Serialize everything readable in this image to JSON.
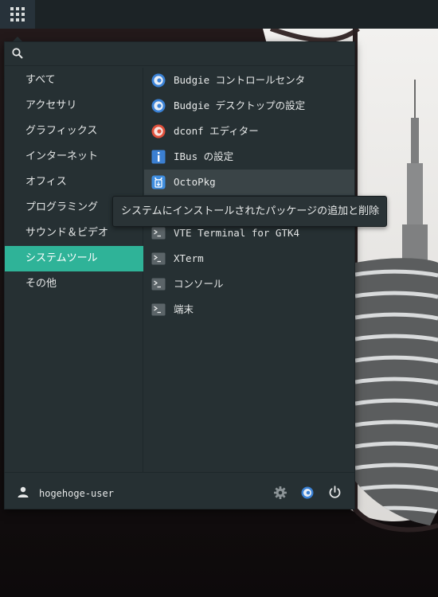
{
  "panel": {
    "apps_icon": "app-grid-icon"
  },
  "search": {
    "placeholder": "",
    "icon": "search-icon"
  },
  "categories": [
    {
      "label": "すべて",
      "active": false
    },
    {
      "label": "アクセサリ",
      "active": false
    },
    {
      "label": "グラフィックス",
      "active": false
    },
    {
      "label": "インターネット",
      "active": false
    },
    {
      "label": "オフィス",
      "active": false
    },
    {
      "label": "プログラミング",
      "active": false
    },
    {
      "label": "サウンド＆ビデオ",
      "active": false
    },
    {
      "label": "システムツール",
      "active": true
    },
    {
      "label": "その他",
      "active": false
    }
  ],
  "apps": [
    {
      "label": "Budgie コントロールセンタ",
      "icon": "budgie-icon"
    },
    {
      "label": "Budgie デスクトップの設定",
      "icon": "budgie-icon"
    },
    {
      "label": "dconf エディター",
      "icon": "dconf-icon"
    },
    {
      "label": "IBus の設定",
      "icon": "ibus-info-icon"
    },
    {
      "label": "OctoPkg",
      "icon": "octopkg-icon",
      "hover": true
    },
    {
      "label": "",
      "icon": "terminal-icon"
    },
    {
      "label": "VTE Terminal for GTK4",
      "icon": "terminal-icon"
    },
    {
      "label": "XTerm",
      "icon": "terminal-icon"
    },
    {
      "label": "コンソール",
      "icon": "terminal-icon"
    },
    {
      "label": "端末",
      "icon": "terminal-icon"
    }
  ],
  "tooltip": {
    "text": "システムにインストールされたパッケージの追加と削除"
  },
  "footer": {
    "user_name": "hogehoge-user",
    "user_icon": "user-icon",
    "settings_icon": "gear-icon",
    "budgie_icon": "budgie-icon",
    "power_icon": "power-icon"
  },
  "colors": {
    "accent": "#2fb398",
    "menu_bg": "#263033",
    "panel_bg": "#1c2326",
    "budgie_blue": "#3b82d6",
    "dconf_red": "#e0503c",
    "info_blue": "#3b7fd1"
  }
}
